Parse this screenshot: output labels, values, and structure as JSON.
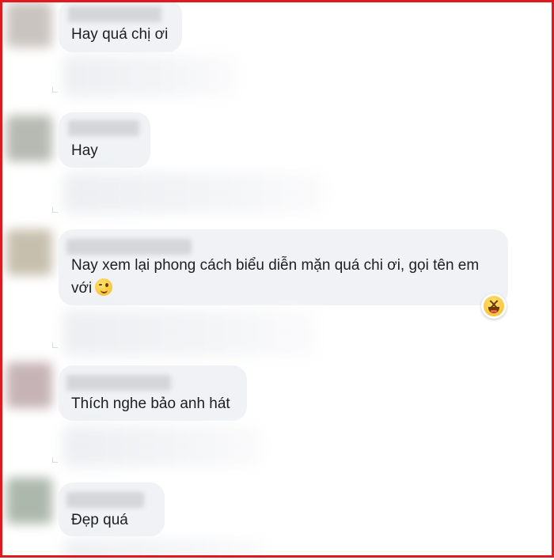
{
  "comments": [
    {
      "text": "Hay quá chị ơi"
    },
    {
      "text": "Hay"
    },
    {
      "text_line1": "Nay xem lại phong cách biểu diễn mặn quá chi ơi, gọi tên em",
      "text_line2": "với"
    },
    {
      "text": "Thích nghe bảo anh hát"
    },
    {
      "text": "Đẹp quá"
    }
  ],
  "icons": {
    "inline_emoji": "wink-emoji-icon",
    "reaction": "laughing-reaction-icon"
  },
  "colors": {
    "frame_border": "#e0191f",
    "bubble_bg": "#f0f2f5",
    "text": "#1c1e21"
  }
}
